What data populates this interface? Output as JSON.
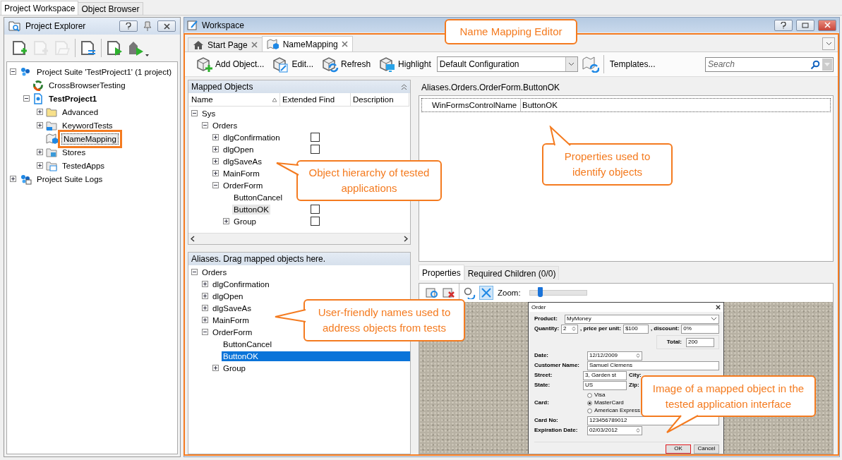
{
  "top_tabs": [
    {
      "label": "Project Workspace",
      "selected": true
    },
    {
      "label": "Object Browser",
      "selected": false
    }
  ],
  "explorer": {
    "title": "Project Explorer",
    "toolbar": [
      {
        "kind": "add-project",
        "disabled": false
      },
      {
        "kind": "add-item",
        "disabled": true
      },
      {
        "kind": "add-existing",
        "disabled": true
      },
      {
        "kind": "properties",
        "disabled": false
      },
      {
        "kind": "run",
        "disabled": false
      },
      {
        "kind": "run-menu",
        "disabled": false
      }
    ],
    "tree": [
      {
        "label": "Project Suite 'TestProject1' (1 project)",
        "kind": "suite",
        "expanded": true,
        "selected": false,
        "children": [
          {
            "label": "CrossBrowserTesting",
            "kind": "cbt",
            "selected": false
          },
          {
            "label": "TestProject1",
            "kind": "project",
            "expanded": true,
            "selected": false,
            "children": [
              {
                "label": "Advanced",
                "kind": "folder",
                "expanded": false,
                "selected": false
              },
              {
                "label": "KeywordTests",
                "kind": "keyword",
                "expanded": false,
                "selected": false
              },
              {
                "label": "NameMapping",
                "kind": "namemap",
                "selected": true
              },
              {
                "label": "Stores",
                "kind": "stores",
                "expanded": false,
                "selected": false
              },
              {
                "label": "TestedApps",
                "kind": "apps",
                "expanded": false,
                "selected": false
              }
            ]
          }
        ]
      },
      {
        "label": "Project Suite Logs",
        "kind": "logs",
        "expanded": false,
        "selected": false
      }
    ]
  },
  "workspace": {
    "title": "Workspace",
    "tabs": [
      {
        "label": "Start Page",
        "kind": "home",
        "selected": false
      },
      {
        "label": "NameMapping",
        "kind": "map",
        "selected": true
      }
    ],
    "toolbar": {
      "buttons": [
        {
          "label": "Add Object...",
          "kind": "add"
        },
        {
          "label": "Edit...",
          "kind": "edit"
        },
        {
          "label": "Refresh",
          "kind": "refresh"
        },
        {
          "label": "Highlight",
          "kind": "highlight"
        }
      ],
      "configuration": "Default Configuration",
      "templates": "Templates...",
      "search": {
        "placeholder": "Search"
      }
    },
    "mapped_objects": {
      "title": "Mapped Objects",
      "columns": [
        "Name",
        "Extended Find",
        "Description"
      ],
      "tree": [
        {
          "label": "Sys",
          "expanded": true,
          "selected": false,
          "children": [
            {
              "label": "Orders",
              "expanded": true,
              "selected": false,
              "children": [
                {
                  "label": "dlgConfirmation",
                  "expanded": false,
                  "selected": false,
                  "checked": false
                },
                {
                  "label": "dlgOpen",
                  "expanded": false,
                  "selected": false,
                  "checked": false
                },
                {
                  "label": "dlgSaveAs",
                  "expanded": false,
                  "selected": false
                },
                {
                  "label": "MainForm",
                  "expanded": false,
                  "selected": false
                },
                {
                  "label": "OrderForm",
                  "expanded": true,
                  "selected": false,
                  "children": [
                    {
                      "label": "ButtonCancel",
                      "selected": false
                    },
                    {
                      "label": "ButtonOK",
                      "selected": true,
                      "checked": false
                    },
                    {
                      "label": "Group",
                      "expanded": false,
                      "selected": false,
                      "checked": false
                    }
                  ]
                }
              ]
            }
          ]
        }
      ]
    },
    "aliases": {
      "title": "Aliases. Drag mapped objects here.",
      "tree": [
        {
          "label": "Orders",
          "expanded": true,
          "selected": false,
          "children": [
            {
              "label": "dlgConfirmation",
              "expanded": false,
              "selected": false
            },
            {
              "label": "dlgOpen",
              "expanded": false,
              "selected": false
            },
            {
              "label": "dlgSaveAs",
              "expanded": false,
              "selected": false
            },
            {
              "label": "MainForm",
              "expanded": false,
              "selected": false
            },
            {
              "label": "OrderForm",
              "expanded": true,
              "selected": false,
              "children": [
                {
                  "label": "ButtonCancel",
                  "selected": false
                },
                {
                  "label": "ButtonOK",
                  "selected": true
                },
                {
                  "label": "Group",
                  "expanded": false,
                  "selected": false
                }
              ]
            }
          ]
        }
      ]
    },
    "object_path": "Aliases.Orders.OrderForm.ButtonOK",
    "properties": [
      {
        "name": "WinFormsControlName",
        "value": "ButtonOK"
      }
    ],
    "property_tabs": [
      {
        "label": "Properties",
        "selected": true
      },
      {
        "label": "Required Children (0/0)",
        "selected": false
      }
    ],
    "image_toolbar": {
      "zoom_label": "Zoom:",
      "zoom": {
        "level": 0.18
      }
    },
    "order_dialog": {
      "title": "Order",
      "product_label": "Product:",
      "product": "MyMoney",
      "quantity_label": "Quantity:",
      "quantity": "2",
      "price_label": ", price per unit:",
      "price": "$100",
      "discount_label": ", discount:",
      "discount": "0%",
      "total_label": "Total:",
      "total": "200",
      "date_label": "Date:",
      "date": "12/12/2009",
      "customer_label": "Customer Name:",
      "customer": "Samuel Clemens",
      "street_label": "Street:",
      "street": "3, Garden st",
      "city_label": "City:",
      "state_label": "State:",
      "state": "US",
      "zip_label": "Zip:",
      "card_label": "Card:",
      "cards": [
        {
          "label": "Visa",
          "selected": false
        },
        {
          "label": "MasterCard",
          "selected": true
        },
        {
          "label": "American Express",
          "selected": false
        }
      ],
      "card_no_label": "Card No:",
      "card_no": "123456789012",
      "exp_label": "Expiration Date:",
      "exp": "02/03/2012",
      "buttons": [
        {
          "label": "OK",
          "kind": "highlighted"
        },
        {
          "label": "Cancel",
          "kind": "normal"
        }
      ]
    }
  },
  "callouts": [
    "Name Mapping Editor",
    "Object hierarchy of tested applications",
    "Properties used to identify objects",
    "User-friendly names used to address objects from tests",
    "Image of a mapped object in the tested application interface"
  ]
}
